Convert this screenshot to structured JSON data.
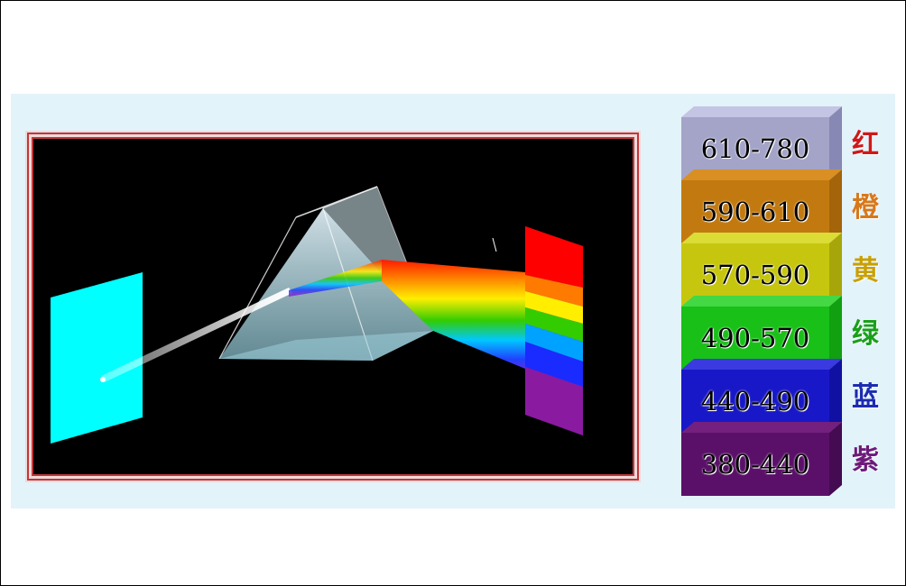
{
  "colors": {
    "panel_bg": "#e3f3fa",
    "stage_bg": "#000000",
    "stage_border": "#c0373a",
    "screen_left": "#00ffff"
  },
  "diagram": {
    "elements": [
      "left-screen",
      "light-beam",
      "glass-prism",
      "dispersed-rainbow",
      "right-spectrum-screen"
    ],
    "spectrum_colors": [
      "#ff0000",
      "#ff7a00",
      "#ffee00",
      "#33cc00",
      "#00a2ff",
      "#1a2bff",
      "#8a1aa0"
    ]
  },
  "legend": {
    "bands": [
      {
        "range": "610-780",
        "name": "红",
        "face": "#a4a4c8",
        "side": "#8888b4",
        "top": "#c4c4e4",
        "name_color": "#d01818"
      },
      {
        "range": "590-610",
        "name": "橙",
        "face": "#c27a10",
        "side": "#a3640a",
        "top": "#d98f24",
        "name_color": "#d8781a"
      },
      {
        "range": "570-590",
        "name": "黄",
        "face": "#c6c60e",
        "side": "#a6a60a",
        "top": "#dcdc36",
        "name_color": "#c8a006"
      },
      {
        "range": "490-570",
        "name": "绿",
        "face": "#18c018",
        "side": "#10a010",
        "top": "#44d844",
        "name_color": "#18a018"
      },
      {
        "range": "440-490",
        "name": "蓝",
        "face": "#1818c8",
        "side": "#1010a2",
        "top": "#3a3ae0",
        "name_color": "#1c2cb0"
      },
      {
        "range": "380-440",
        "name": "紫",
        "face": "#5a1068",
        "side": "#440a52",
        "top": "#74207e",
        "name_color": "#6e1a7a"
      }
    ]
  }
}
